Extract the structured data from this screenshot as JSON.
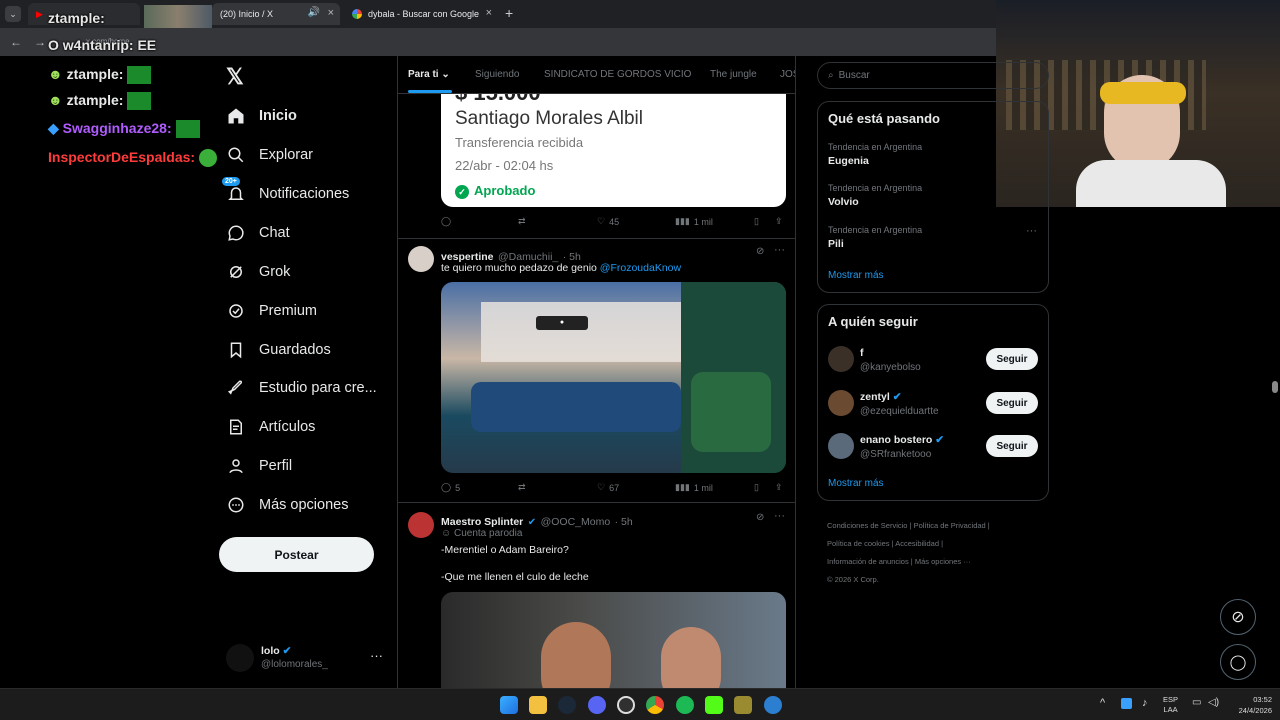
{
  "browser": {
    "tabs": [
      {
        "label": "(20) Inicio / X",
        "active": true
      },
      {
        "label": "dybala - Buscar con Google",
        "active": false
      }
    ],
    "url_fragment": "x.com/home"
  },
  "sidebar": {
    "items": [
      {
        "label": "Inicio",
        "icon": "home-icon"
      },
      {
        "label": "Explorar",
        "icon": "search-icon"
      },
      {
        "label": "Notificaciones",
        "icon": "bell-icon",
        "badge": "20+"
      },
      {
        "label": "Chat",
        "icon": "chat-icon"
      },
      {
        "label": "Grok",
        "icon": "grok-icon"
      },
      {
        "label": "Premium",
        "icon": "premium-icon"
      },
      {
        "label": "Guardados",
        "icon": "bookmark-icon"
      },
      {
        "label": "Estudio para cre...",
        "icon": "rocket-icon"
      },
      {
        "label": "Artículos",
        "icon": "articles-icon"
      },
      {
        "label": "Perfil",
        "icon": "person-icon"
      },
      {
        "label": "Más opciones",
        "icon": "more-circle-icon"
      }
    ],
    "post_button": "Postear",
    "account": {
      "name": "lolo",
      "handle": "@lolomorales_"
    }
  },
  "feed": {
    "tabs": [
      "Para ti",
      "Siguiendo",
      "SINDICATO DE GORDOS VICIO",
      "The jungle",
      "JOS"
    ],
    "card": {
      "amount": "$ 15.000",
      "name": "Santiago Morales Albil",
      "subtitle": "Transferencia recibida",
      "date": "22/abr - 02:04 hs",
      "status": "Aprobado"
    },
    "tweet0_actions": {
      "replies": "",
      "likes": "45",
      "views": "1 mil"
    },
    "tweet1": {
      "name": "vespertine",
      "handle": "@Damuchii_",
      "time": "· 5h",
      "text": "te quiero mucho pedazo de genio",
      "mention": "@FrozoudaKnow",
      "replies": "5",
      "likes": "67",
      "views": "1 mil"
    },
    "tweet2": {
      "name": "Maestro Splinter",
      "handle": "@OOC_Momo",
      "time": "· 5h",
      "label": "Cuenta parodia",
      "line1": "-Merentiel o Adam Bareiro?",
      "line2": "-Que me llenen el culo de leche"
    }
  },
  "right": {
    "search_placeholder": "Buscar",
    "trends_title": "Qué está pasando",
    "trends": [
      {
        "category": "Tendencia en Argentina",
        "name": "Eugenia"
      },
      {
        "category": "Tendencia en Argentina",
        "name": "Volvio"
      },
      {
        "category": "Tendencia en Argentina",
        "name": "Pili"
      }
    ],
    "show_more": "Mostrar más",
    "follow_title": "A quién seguir",
    "follow": [
      {
        "name": "f",
        "handle": "@kanyebolso",
        "button": "Seguir"
      },
      {
        "name": "zentyl",
        "handle": "@ezequielduartte",
        "button": "Seguir"
      },
      {
        "name": "enano bostero",
        "handle": "@SRfranketooo",
        "button": "Seguir"
      }
    ],
    "show_more2": "Mostrar más",
    "footer": [
      "Condiciones de Servicio",
      "Política de Privacidad",
      "Política de cookies",
      "Accesibilidad",
      "Información de anuncios",
      "Más opciones ···",
      "© 2026 X Corp."
    ]
  },
  "chat_overlay": [
    {
      "user": "ztample",
      "msg": "",
      "color": "#e7e7e7"
    },
    {
      "user": "w4ntanrip",
      "msg": "EE",
      "color": "#e7e7e7"
    },
    {
      "user": "ztample",
      "msg": "",
      "color": "#e7e7e7"
    },
    {
      "user": "ztample",
      "msg": "",
      "color": "#e7e7e7"
    },
    {
      "user": "Swagginhaze28",
      "msg": "",
      "color": "#b05cff"
    },
    {
      "user": "InspectorDeEspaldas",
      "msg": "",
      "color": "#ff3b3b"
    }
  ],
  "system": {
    "lang": "ESP",
    "layout": "LAA",
    "time": "03:52",
    "date": "24/4/2026"
  },
  "colors": {
    "accent": "#1d9bf0",
    "approved": "#00a650",
    "bg": "#000000"
  }
}
